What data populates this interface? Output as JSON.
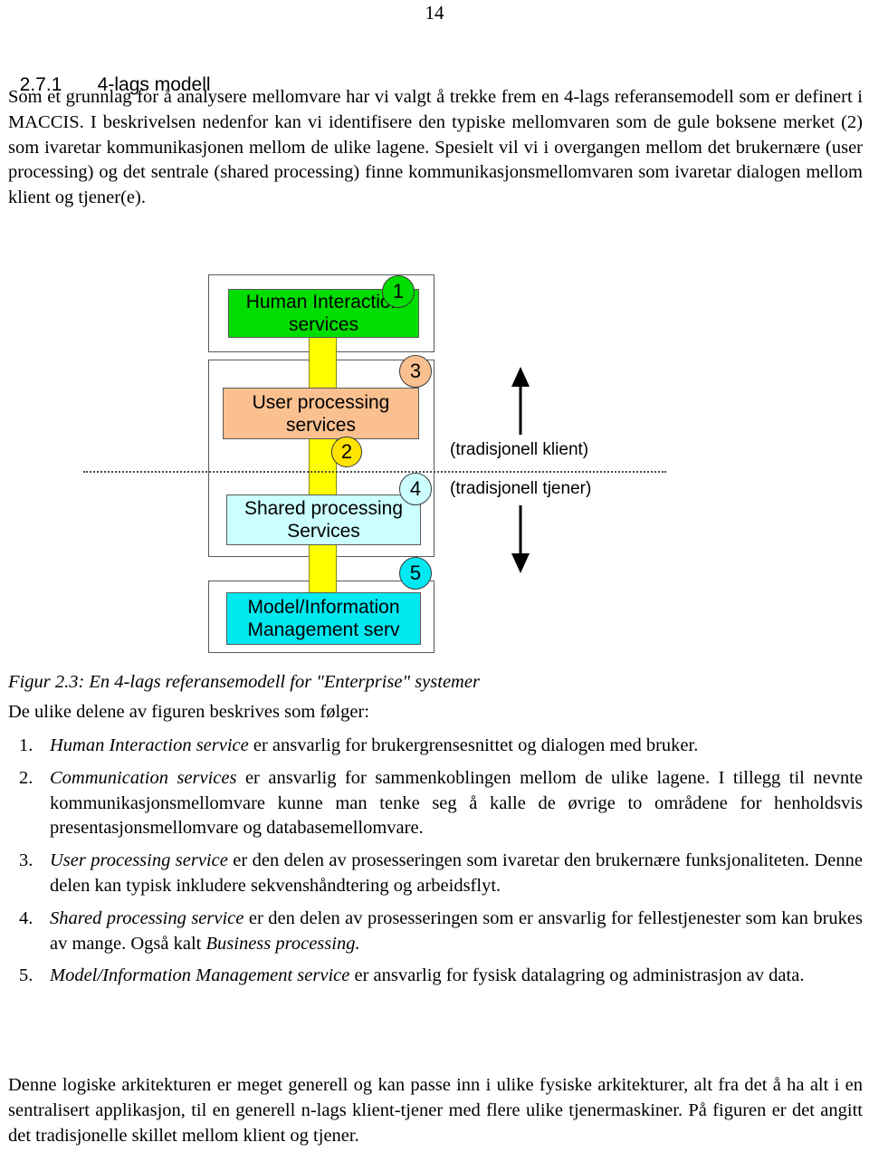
{
  "page": {
    "number": "14"
  },
  "heading": {
    "number": "2.7.1",
    "title": "4-lags modell"
  },
  "intro": {
    "text": "Som et grunnlag for å analysere mellomvare har vi valgt å trekke frem en 4-lags referansemodell som er definert i MACCIS. I beskrivelsen nedenfor kan vi identifisere den typiske mellomvaren som de gule boksene merket (2) som ivaretar kommunikasjonen mellom de ulike lagene. Spesielt vil vi i overgangen mellom det brukernære (user processing) og det sentrale (shared processing) finne kommunikasjonsmellomvaren som ivaretar dialogen mellom klient og tjener(e)."
  },
  "figure": {
    "layers": [
      {
        "id": "human-interaction",
        "label": "Human Interaction\nservices",
        "fill": "#00DD00",
        "badge": "1",
        "badge_fill": "#00DD00"
      },
      {
        "id": "user-processing",
        "label": "User  processing\nservices",
        "fill": "#FAC090",
        "badge": "3",
        "badge_fill": "#FAC090"
      },
      {
        "id": "shared-processing",
        "label": "Shared processing\nServices",
        "fill": "#CCFFFF",
        "badge": "4",
        "badge_fill": "#CCFFFF"
      },
      {
        "id": "model-information",
        "label": "Model/Information\nManagement serv",
        "fill": "#00E8F0",
        "badge": "5",
        "badge_fill": "#00E8F0"
      }
    ],
    "connector": {
      "badge": "2",
      "badge_fill": "#FFE400",
      "fill": "#FFFF00"
    },
    "side_labels": {
      "client": "(tradisjonell klient)",
      "server": "(tradisjonell tjener)"
    }
  },
  "caption": {
    "text": "Figur 2.3: En 4-lags referansemodell for \"Enterprise\" systemer"
  },
  "follows": {
    "text": "De ulike delene av figuren beskrives som følger:"
  },
  "list": [
    {
      "marker": "1.",
      "emphasis": "Human Interaction service",
      "rest": " er ansvarlig for brukergrensesnittet og dialogen med bruker."
    },
    {
      "marker": "2.",
      "emphasis": "Communication services",
      "rest": " er ansvarlig for sammenkoblingen mellom de ulike lagene. I tillegg til nevnte kommunikasjonsmellomvare kunne man tenke seg å kalle de øvrige to områdene for henholdsvis presentasjonsmellomvare og databasemellomvare."
    },
    {
      "marker": "3.",
      "emphasis": "User processing service",
      "rest": " er den delen av prosesseringen som ivaretar den brukernære funksjonaliteten. Denne delen kan typisk inkludere sekvenshåndtering og arbeidsflyt."
    },
    {
      "marker": "4.",
      "emphasis": "Shared processing service",
      "rest": " er den delen av prosesseringen som er ansvarlig for fellestjenester som kan brukes av mange. Også kalt ",
      "emphasis2": "Business processing.",
      "rest2": ""
    },
    {
      "marker": "5.",
      "emphasis": "Model/Information Management service",
      "rest": " er ansvarlig for fysisk datalagring og administrasjon av data."
    }
  ],
  "closing": {
    "text": "Denne logiske arkitekturen er meget generell og kan passe inn i ulike fysiske arkitekturer, alt fra det å ha alt i en sentralisert applikasjon, til en generell n-lags klient-tjener med flere ulike tjenermaskiner. På figuren er det angitt det tradisjonelle skillet mellom klient og tjener."
  }
}
